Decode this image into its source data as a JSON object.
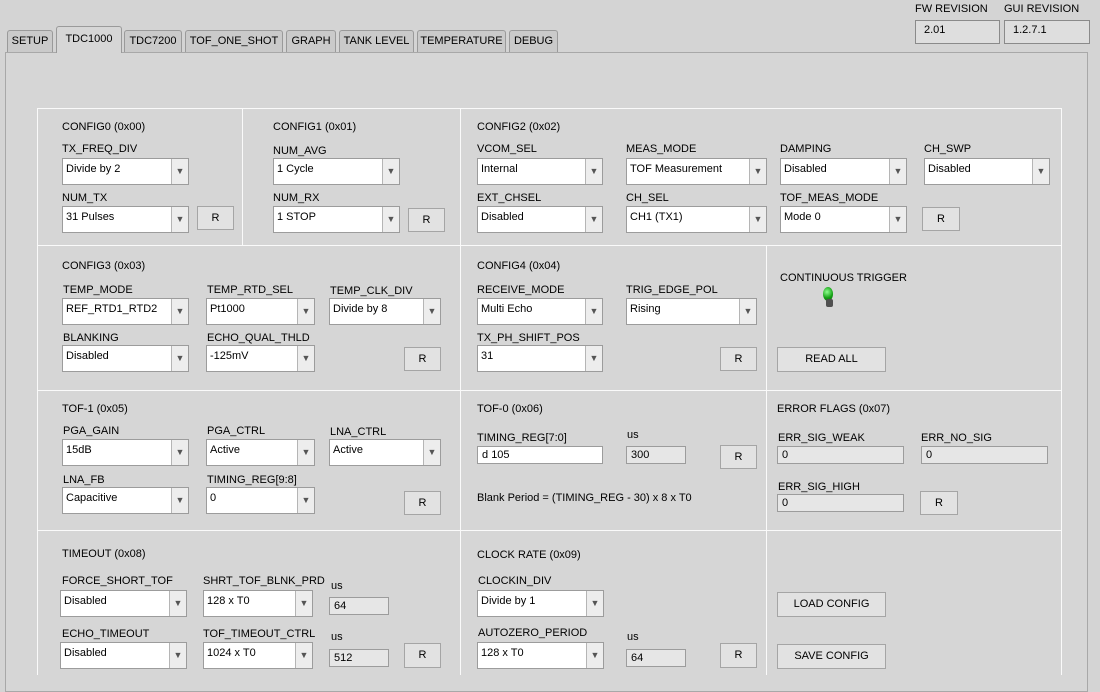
{
  "tabs": [
    {
      "label": "SETUP"
    },
    {
      "label": "TDC1000"
    },
    {
      "label": "TDC7200"
    },
    {
      "label": "TOF_ONE_SHOT"
    },
    {
      "label": "GRAPH"
    },
    {
      "label": "TANK LEVEL"
    },
    {
      "label": "TEMPERATURE"
    },
    {
      "label": "DEBUG"
    }
  ],
  "fw": {
    "label": "FW REVISION",
    "value": "2.01"
  },
  "gui": {
    "label": "GUI REVISION",
    "value": "1.2.7.1"
  },
  "r_label": "R",
  "us_label": "us",
  "config0": {
    "title": "CONFIG0 (0x00)",
    "tx_freq_div": {
      "label": "TX_FREQ_DIV",
      "value": "Divide by 2"
    },
    "num_tx": {
      "label": "NUM_TX",
      "value": "31 Pulses"
    }
  },
  "config1": {
    "title": "CONFIG1 (0x01)",
    "num_avg": {
      "label": "NUM_AVG",
      "value": "1 Cycle"
    },
    "num_rx": {
      "label": "NUM_RX",
      "value": "1 STOP"
    }
  },
  "config2": {
    "title": "CONFIG2 (0x02)",
    "vcom_sel": {
      "label": "VCOM_SEL",
      "value": "Internal"
    },
    "meas_mode": {
      "label": "MEAS_MODE",
      "value": "TOF Measurement"
    },
    "damping": {
      "label": "DAMPING",
      "value": "Disabled"
    },
    "ch_swp": {
      "label": "CH_SWP",
      "value": "Disabled"
    },
    "ext_chsel": {
      "label": "EXT_CHSEL",
      "value": "Disabled"
    },
    "ch_sel": {
      "label": "CH_SEL",
      "value": "CH1 (TX1)"
    },
    "tof_meas_mode": {
      "label": "TOF_MEAS_MODE",
      "value": "Mode 0"
    }
  },
  "config3": {
    "title": "CONFIG3 (0x03)",
    "temp_mode": {
      "label": "TEMP_MODE",
      "value": "REF_RTD1_RTD2"
    },
    "temp_rtd_sel": {
      "label": "TEMP_RTD_SEL",
      "value": "Pt1000"
    },
    "temp_clk_div": {
      "label": "TEMP_CLK_DIV",
      "value": "Divide by 8"
    },
    "blanking": {
      "label": "BLANKING",
      "value": "Disabled"
    },
    "echo_qual_thld": {
      "label": "ECHO_QUAL_THLD",
      "value": "-125mV"
    }
  },
  "config4": {
    "title": "CONFIG4 (0x04)",
    "receive_mode": {
      "label": "RECEIVE_MODE",
      "value": "Multi Echo"
    },
    "trig_edge_pol": {
      "label": "TRIG_EDGE_POL",
      "value": "Rising"
    },
    "tx_ph_shift_pos": {
      "label": "TX_PH_SHIFT_POS",
      "value": "31"
    }
  },
  "trigger": {
    "label": "CONTINUOUS TRIGGER",
    "read_all": "READ ALL"
  },
  "tof1": {
    "title": "TOF-1 (0x05)",
    "pga_gain": {
      "label": "PGA_GAIN",
      "value": "15dB"
    },
    "pga_ctrl": {
      "label": "PGA_CTRL",
      "value": "Active"
    },
    "lna_ctrl": {
      "label": "LNA_CTRL",
      "value": "Active"
    },
    "lna_fb": {
      "label": "LNA_FB",
      "value": "Capacitive"
    },
    "timing_reg_98": {
      "label": "TIMING_REG[9:8]",
      "value": "0"
    }
  },
  "tof0": {
    "title": "TOF-0 (0x06)",
    "timing_reg_70": {
      "label": "TIMING_REG[7:0]",
      "prefix": "d",
      "value": "105"
    },
    "us_value": "300",
    "formula": "Blank Period = (TIMING_REG - 30) x 8 x T0"
  },
  "error_flags": {
    "title": "ERROR FLAGS (0x07)",
    "err_sig_weak": {
      "label": "ERR_SIG_WEAK",
      "value": "0"
    },
    "err_no_sig": {
      "label": "ERR_NO_SIG",
      "value": "0"
    },
    "err_sig_high": {
      "label": "ERR_SIG_HIGH",
      "value": "0"
    }
  },
  "timeout": {
    "title": "TIMEOUT (0x08)",
    "force_short_tof": {
      "label": "FORCE_SHORT_TOF",
      "value": "Disabled"
    },
    "shrt_tof_blnk_prd": {
      "label": "SHRT_TOF_BLNK_PRD",
      "value": "128 x T0"
    },
    "shrt_us": "64",
    "echo_timeout": {
      "label": "ECHO_TIMEOUT",
      "value": "Disabled"
    },
    "tof_timeout_ctrl": {
      "label": "TOF_TIMEOUT_CTRL",
      "value": "1024 x T0"
    },
    "timeout_us": "512"
  },
  "clock_rate": {
    "title": "CLOCK RATE (0x09)",
    "clockin_div": {
      "label": "CLOCKIN_DIV",
      "value": "Divide by 1"
    },
    "autozero_period": {
      "label": "AUTOZERO_PERIOD",
      "value": "128 x T0"
    },
    "autozero_us": "64"
  },
  "config_buttons": {
    "load": "LOAD CONFIG",
    "save": "SAVE CONFIG"
  },
  "colors": {
    "led": "#14a014",
    "background": "#d4d4d4"
  }
}
